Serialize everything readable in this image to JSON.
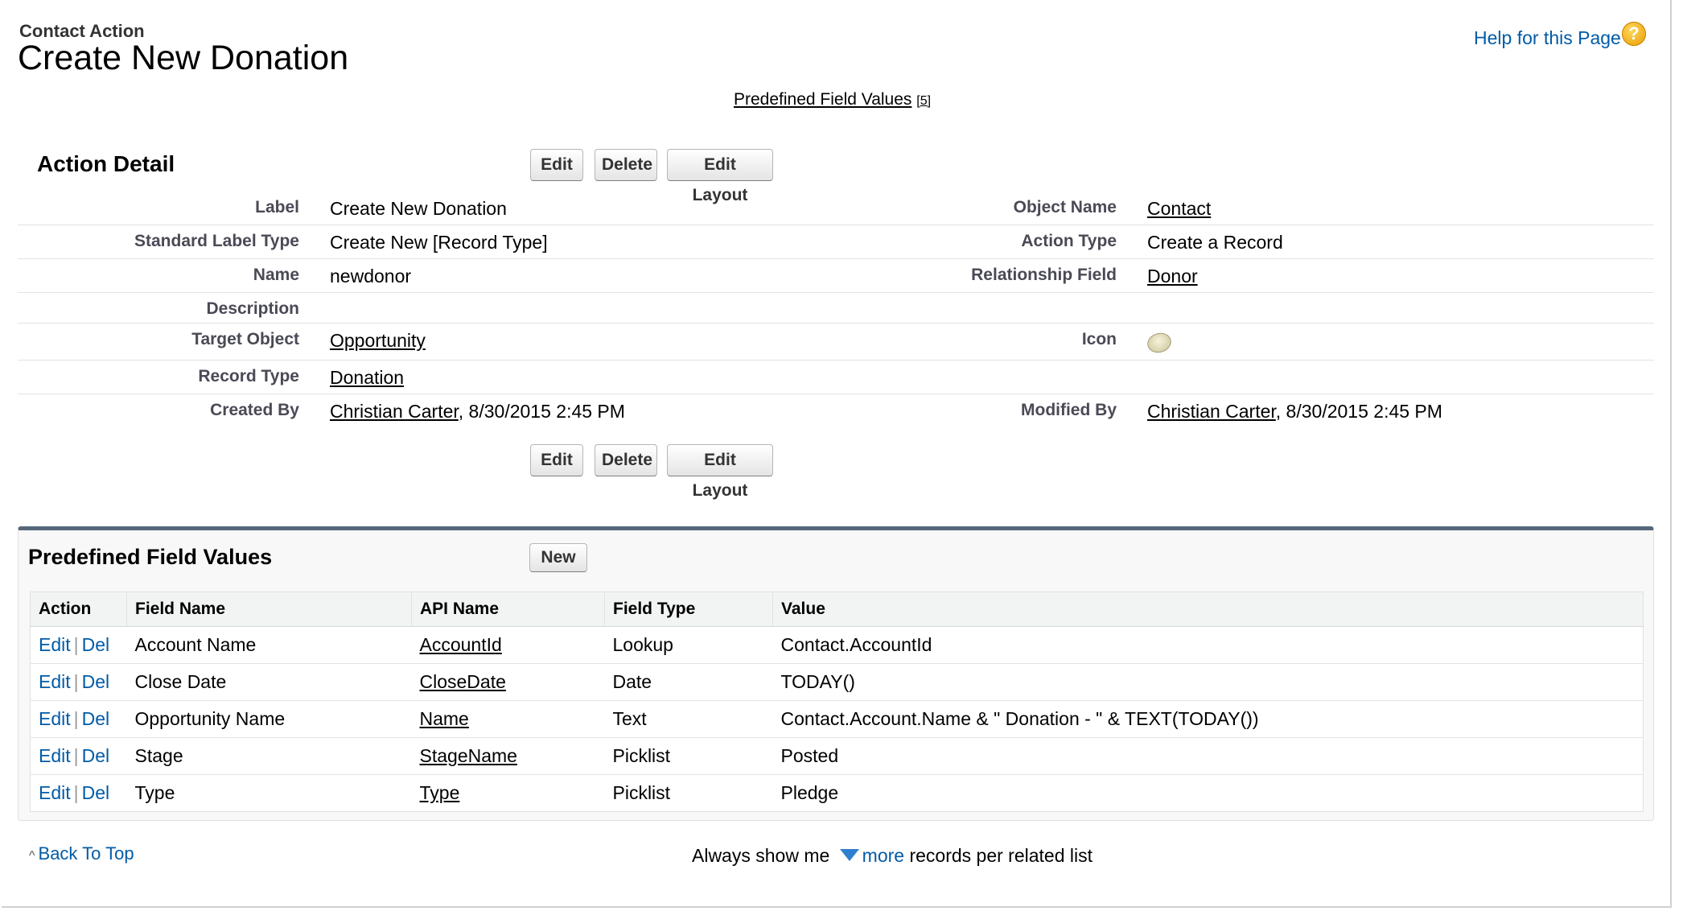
{
  "header": {
    "subtitle": "Contact Action",
    "title": "Create New Donation",
    "help_link": "Help for this Page",
    "help_icon": "help-question-icon"
  },
  "top_link": {
    "label": "Predefined Field Values",
    "count": "[5]"
  },
  "action_detail": {
    "title": "Action Detail",
    "buttons": {
      "edit": "Edit",
      "delete": "Delete",
      "edit_layout": "Edit Layout"
    },
    "left_fields": [
      {
        "label": "Label",
        "value": "Create New Donation"
      },
      {
        "label": "Standard Label Type",
        "value": "Create New [Record Type]"
      },
      {
        "label": "Name",
        "value": "newdonor"
      },
      {
        "label": "Description",
        "value": ""
      },
      {
        "label": "Target Object",
        "value": "Opportunity"
      },
      {
        "label": "Record Type",
        "value": "Donation"
      },
      {
        "label": "Created By",
        "value": "Christian Carter",
        "suffix": ", 8/30/2015 2:45 PM"
      }
    ],
    "right_fields": [
      {
        "label": "Object Name",
        "value": "Contact"
      },
      {
        "label": "Action Type",
        "value": "Create a Record"
      },
      {
        "label": "Relationship Field",
        "value": "Donor"
      },
      {
        "label": "Icon",
        "value": "donation-icon"
      },
      {
        "label": "Modified By",
        "value": "Christian Carter",
        "suffix": ", 8/30/2015 2:45 PM"
      }
    ]
  },
  "predefined": {
    "title": "Predefined Field Values",
    "new_button": "New",
    "columns": [
      "Action",
      "Field Name",
      "API Name",
      "Field Type",
      "Value"
    ],
    "edit_label": "Edit",
    "del_label": "Del",
    "separator": "|",
    "rows": [
      {
        "field_name": "Account Name",
        "api_name": "AccountId",
        "field_type": "Lookup",
        "value": "Contact.AccountId"
      },
      {
        "field_name": "Close Date",
        "api_name": "CloseDate",
        "field_type": "Date",
        "value": "TODAY()"
      },
      {
        "field_name": "Opportunity Name",
        "api_name": "Name",
        "field_type": "Text",
        "value": "Contact.Account.Name & \" Donation - \" & TEXT(TODAY())"
      },
      {
        "field_name": "Stage",
        "api_name": "StageName",
        "field_type": "Picklist",
        "value": "Posted"
      },
      {
        "field_name": "Type",
        "api_name": "Type",
        "field_type": "Picklist",
        "value": "Pledge"
      }
    ]
  },
  "footer": {
    "back_to_top": "Back To Top",
    "always_show": "Always show me",
    "more": "more",
    "records_text": "records per related list"
  },
  "colors": {
    "link_blue": "#015ba7",
    "section_border": "#56677a",
    "help_icon": "#e89b00"
  }
}
